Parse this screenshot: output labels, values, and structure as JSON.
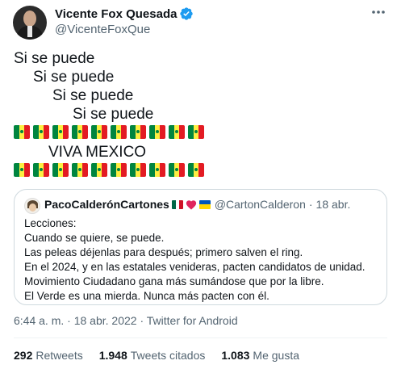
{
  "author": {
    "display_name": "Vicente Fox Quesada",
    "handle": "@VicenteFoxQue",
    "verified": true
  },
  "tweet": {
    "lines": [
      "Si se puede",
      "Si se puede",
      "Si se puede",
      "Si se puede",
      "VIVA MEXICO"
    ],
    "flag_emoji": "senegal-flag",
    "flag_row_count": 10
  },
  "quote": {
    "name": "PacoCalderónCartones",
    "name_emojis": [
      "mexico-flag",
      "red-heart",
      "ukraine-flag"
    ],
    "handle": "@CartonCalderon",
    "separator": "·",
    "date": "18 abr.",
    "body_lines": [
      "Lecciones:",
      "Cuando se quiere, se puede.",
      "Las peleas déjenlas para después; primero salven el ring.",
      "En el 2024, y en las estatales venideras, pacten candidatos de unidad.",
      "Movimiento Ciudadano gana más sumándose que por la libre.",
      "El Verde es una mierda. Nunca más pacten con él."
    ]
  },
  "meta": {
    "time": "6:44 a. m.",
    "sep1": "·",
    "date": "18 abr. 2022",
    "sep2": "·",
    "client": "Twitter for Android"
  },
  "stats": {
    "retweets_count": "292",
    "retweets_label": "Retweets",
    "quotes_count": "1.948",
    "quotes_label": "Tweets citados",
    "likes_count": "1.083",
    "likes_label": "Me gusta"
  },
  "colors": {
    "verified_blue": "#1d9bf0",
    "text_secondary": "#536471",
    "border": "#cfd9de"
  }
}
